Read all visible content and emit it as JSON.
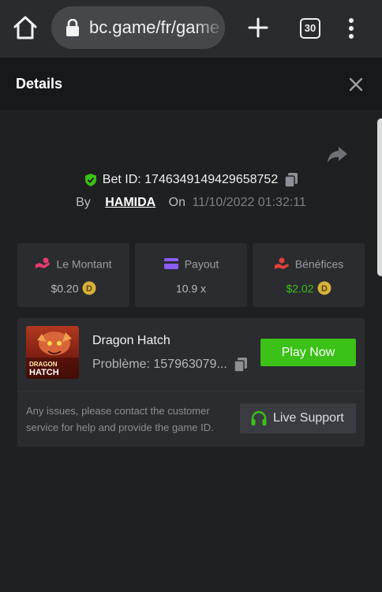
{
  "browser": {
    "url": "bc.game/fr/game",
    "tab_count": "30"
  },
  "panel": {
    "title": "Details"
  },
  "bet": {
    "id_label": "Bet ID:",
    "id_value": "1746349149429658752",
    "by_label": "By",
    "username": "HAMIDA",
    "on_label": "On",
    "date": "11/10/2022 01:32:11"
  },
  "stats": [
    {
      "label": "Le Montant",
      "value": "$0.20",
      "icon": "pink-hand-coin-icon",
      "coin": "D"
    },
    {
      "label": "Payout",
      "value": "10.9 x",
      "icon": "purple-card-icon"
    },
    {
      "label": "Bénéfices",
      "value": "$2.02",
      "icon": "red-coins-hand-icon",
      "coin": "D",
      "color": "#3bc117"
    }
  ],
  "game": {
    "name": "Dragon Hatch",
    "problem": "Problème: 157963079...",
    "play_label": "Play Now",
    "thumb_text": "DRAGON HATCH"
  },
  "support": {
    "text": "Any issues, please contact the customer service for help and provide the game ID.",
    "button_label": "Live Support"
  },
  "colors": {
    "accent_green": "#3bc117",
    "panel_bg": "#2a2c2f",
    "page_bg": "#1f2022"
  }
}
